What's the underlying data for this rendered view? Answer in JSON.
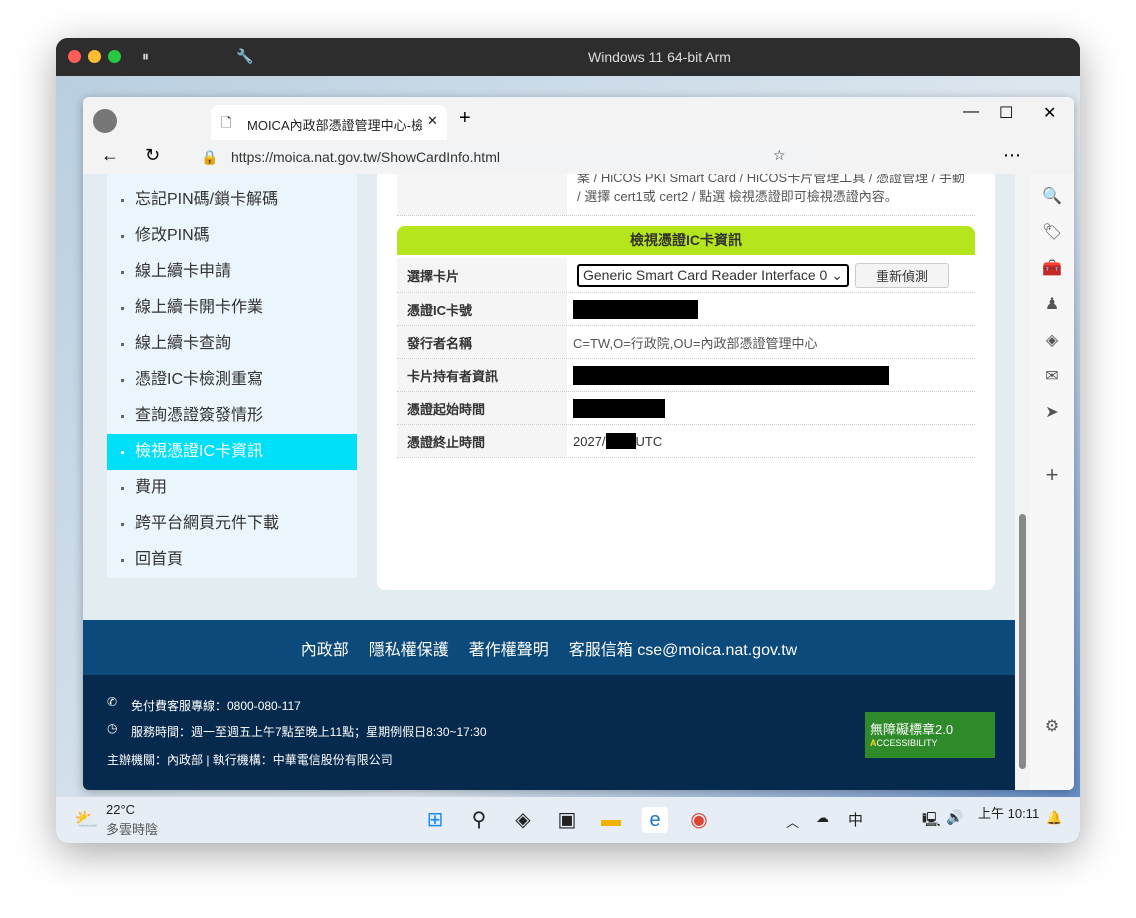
{
  "mac": {
    "title": "Windows 11 64-bit Arm"
  },
  "browser": {
    "tab_title": "MOICA內政部憑證管理中心-檢視",
    "url": "https://moica.nat.gov.tw/ShowCardInfo.html"
  },
  "sidebar": {
    "items": [
      {
        "label": "忘記PIN碼/鎖卡解碼"
      },
      {
        "label": "修改PIN碼"
      },
      {
        "label": "線上續卡申請"
      },
      {
        "label": "線上續卡開卡作業"
      },
      {
        "label": "線上續卡查詢"
      },
      {
        "label": "憑證IC卡檢測重寫"
      },
      {
        "label": "查詢憑證簽發情形"
      },
      {
        "label": "檢視憑證IC卡資訊",
        "active": true
      },
      {
        "label": "費用"
      },
      {
        "label": "跨平台網頁元件下載"
      },
      {
        "label": "回首頁"
      }
    ]
  },
  "main": {
    "instructions_line1": "案 / HiCOS PKI Smart Card / HiCOS卡片管理工具 / 憑證管理 / 手動",
    "instructions_line2": "/ 選擇 cert1或 cert2 / 點選 檢視憑證即可檢視憑證內容。",
    "section_title": "檢視憑證IC卡資訊",
    "card_label": "選擇卡片",
    "card_select": "Generic Smart Card Reader Interface 0",
    "redetect_button": "重新偵測",
    "rows": [
      {
        "label": "憑證IC卡號",
        "value": ""
      },
      {
        "label": "發行者名稱",
        "value": "C=TW,O=行政院,OU=內政部憑證管理中心"
      },
      {
        "label": "卡片持有者資訊",
        "value": ""
      },
      {
        "label": "憑證起始時間",
        "value": ""
      },
      {
        "label": "憑證終止時間",
        "value_prefix": "2027/",
        "value_suffix": "UTC"
      }
    ]
  },
  "footer": {
    "links": [
      "內政部",
      "隱私權保護",
      "著作權聲明",
      "客服信箱 cse@moica.nat.gov.tw"
    ],
    "hotline": "免付費客服專線：0800-080-117",
    "hours": "服務時間：週一至週五上午7點至晚上11點；星期例假日8:30~17:30",
    "org": "主辦機關：內政部 | 執行機構：中華電信股份有限公司",
    "badge_line1": "無障礙標章2.0",
    "badge_line2": "CCESSIBILITY"
  },
  "taskbar": {
    "temp": "22°C",
    "weather": "多雲時陰",
    "ime": "中",
    "time": "上午 10:11"
  }
}
